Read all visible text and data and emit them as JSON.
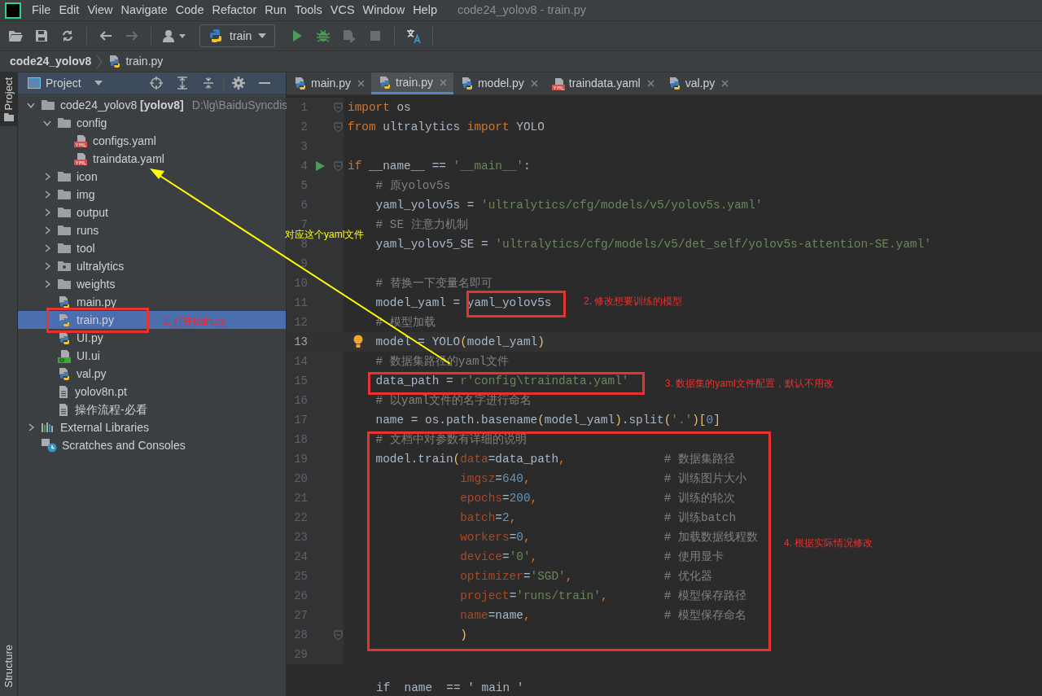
{
  "window": {
    "menu": [
      "File",
      "Edit",
      "View",
      "Navigate",
      "Code",
      "Refactor",
      "Run",
      "Tools",
      "VCS",
      "Window",
      "Help"
    ],
    "title": "code24_yolov8 - train.py"
  },
  "toolbar": [
    {
      "kind": "open",
      "disabled": false
    },
    {
      "kind": "save",
      "disabled": false
    },
    {
      "kind": "sync",
      "disabled": false
    },
    {
      "kind": "back",
      "disabled": false
    },
    {
      "kind": "forward",
      "disabled": true
    },
    {
      "kind": "user",
      "disabled": false
    },
    {
      "kind": "config",
      "label": "train",
      "disabled": false
    },
    {
      "kind": "run",
      "disabled": false
    },
    {
      "kind": "debug",
      "disabled": false
    },
    {
      "kind": "coverage",
      "disabled": true
    },
    {
      "kind": "stop",
      "disabled": true
    },
    {
      "kind": "translate",
      "disabled": false
    }
  ],
  "breadcrumb": [
    "code24_yolov8",
    "train.py"
  ],
  "side_strip": [
    "Project",
    "Structure"
  ],
  "project_panel": {
    "title": "Project",
    "tree": [
      {
        "label": "code24_yolov8 **[yolov8]**",
        "path": "D:\\lg\\BaiduSyncdis",
        "kind": "folder",
        "expanded": true,
        "selected": false,
        "children": [
          {
            "label": "config",
            "kind": "folder",
            "expanded": true,
            "selected": false,
            "children": [
              {
                "label": "configs.yaml",
                "kind": "yaml",
                "selected": false
              },
              {
                "label": "traindata.yaml",
                "kind": "yaml",
                "selected": false
              }
            ]
          },
          {
            "label": "icon",
            "kind": "folder",
            "expanded": false,
            "selected": false
          },
          {
            "label": "img",
            "kind": "folder",
            "expanded": false,
            "selected": false
          },
          {
            "label": "output",
            "kind": "folder",
            "expanded": false,
            "selected": false
          },
          {
            "label": "runs",
            "kind": "folder",
            "expanded": false,
            "selected": false
          },
          {
            "label": "tool",
            "kind": "folder",
            "expanded": false,
            "selected": false
          },
          {
            "label": "ultralytics",
            "kind": "package",
            "expanded": false,
            "selected": false
          },
          {
            "label": "weights",
            "kind": "folder",
            "expanded": false,
            "selected": false
          },
          {
            "label": "main.py",
            "kind": "python",
            "selected": false
          },
          {
            "label": "train.py",
            "kind": "python",
            "selected": true
          },
          {
            "label": "UI.py",
            "kind": "python",
            "selected": false
          },
          {
            "label": "UI.ui",
            "kind": "qt",
            "selected": false
          },
          {
            "label": "val.py",
            "kind": "python",
            "selected": false
          },
          {
            "label": "yolov8n.pt",
            "kind": "file",
            "selected": false
          },
          {
            "label": "操作流程-必看",
            "kind": "file",
            "selected": false
          }
        ]
      },
      {
        "label": "External Libraries",
        "kind": "libraries",
        "expanded": false,
        "selected": false
      },
      {
        "label": "Scratches and Consoles",
        "kind": "scratches",
        "selected": false
      }
    ]
  },
  "tabs": [
    {
      "label": "main.py",
      "kind": "python",
      "selected": false
    },
    {
      "label": "train.py",
      "kind": "python",
      "selected": true
    },
    {
      "label": "model.py",
      "kind": "python",
      "selected": false
    },
    {
      "label": "traindata.yaml",
      "kind": "yaml",
      "selected": false
    },
    {
      "label": "val.py",
      "kind": "python",
      "selected": false
    }
  ],
  "code": {
    "lines": [
      {
        "number": "1",
        "kind": "plain",
        "fold": true,
        "current": false,
        "tokens": [
          {
            "kind": "kw",
            "text": "import"
          },
          {
            "kind": "plain",
            "text": " os"
          }
        ]
      },
      {
        "number": "2",
        "kind": "plain",
        "fold": true,
        "current": false,
        "tokens": [
          {
            "kind": "kw",
            "text": "from"
          },
          {
            "kind": "plain",
            "text": " ultralytics "
          },
          {
            "kind": "kw",
            "text": "import"
          },
          {
            "kind": "plain",
            "text": " YOLO"
          }
        ]
      },
      {
        "number": "3",
        "kind": "plain",
        "fold": false,
        "current": false
      },
      {
        "number": "4",
        "kind": "run",
        "fold": true,
        "current": false,
        "tokens": [
          {
            "kind": "kw",
            "text": "if"
          },
          {
            "kind": "plain",
            "text": " __name__ == "
          },
          {
            "kind": "str",
            "text": "'__main__'"
          },
          {
            "kind": "plain",
            "text": ":"
          }
        ]
      },
      {
        "number": "5",
        "kind": "plain",
        "fold": false,
        "current": false,
        "tokens": [
          {
            "kind": "cm",
            "text": "    # 原yolov5s"
          }
        ]
      },
      {
        "number": "6",
        "kind": "plain",
        "fold": false,
        "current": false,
        "tokens": [
          {
            "kind": "plain",
            "text": "    yaml_yolov5s = "
          },
          {
            "kind": "str",
            "text": "'ultralytics/cfg/models/v5/yolov5s.yaml'"
          }
        ]
      },
      {
        "number": "7",
        "kind": "plain",
        "fold": false,
        "current": false,
        "tokens": [
          {
            "kind": "cm",
            "text": "    # SE 注意力机制"
          }
        ]
      },
      {
        "number": "8",
        "kind": "plain",
        "fold": false,
        "current": false,
        "tokens": [
          {
            "kind": "plain",
            "text": "    yaml_yolov5_SE = "
          },
          {
            "kind": "str",
            "text": "'ultralytics/cfg/models/v5/det_self/yolov5s-attention-SE.yaml'"
          }
        ]
      },
      {
        "number": "9",
        "kind": "plain",
        "fold": false,
        "current": false
      },
      {
        "number": "10",
        "kind": "plain",
        "fold": false,
        "current": false,
        "tokens": [
          {
            "kind": "cm",
            "text": "    # 替换一下变量名即可"
          }
        ]
      },
      {
        "number": "11",
        "kind": "plain",
        "fold": false,
        "current": false,
        "tokens": [
          {
            "kind": "plain",
            "text": "    model_yaml = yaml_yolov5s"
          }
        ]
      },
      {
        "number": "12",
        "kind": "plain",
        "fold": false,
        "current": false,
        "tokens": [
          {
            "kind": "cm",
            "text": "    # 模型加载"
          }
        ]
      },
      {
        "number": "13",
        "kind": "bulb",
        "fold": false,
        "current": true,
        "tokens": [
          {
            "kind": "plain",
            "text": "    model = YOLO"
          },
          {
            "kind": "br",
            "text": "("
          },
          {
            "kind": "plain",
            "text": "model_yaml"
          },
          {
            "kind": "br",
            "text": ")"
          }
        ]
      },
      {
        "number": "14",
        "kind": "plain",
        "fold": false,
        "current": false,
        "tokens": [
          {
            "kind": "cm",
            "text": "    # 数据集路径的yaml文件"
          }
        ]
      },
      {
        "number": "15",
        "kind": "plain",
        "fold": false,
        "current": false,
        "tokens": [
          {
            "kind": "plain",
            "text": "    data_path = "
          },
          {
            "kind": "str",
            "text": "r'config\\traindata.yaml'"
          }
        ]
      },
      {
        "number": "16",
        "kind": "plain",
        "fold": false,
        "current": false,
        "tokens": [
          {
            "kind": "cm",
            "text": "    # 以yaml文件的名字进行命名"
          }
        ]
      },
      {
        "number": "17",
        "kind": "plain",
        "fold": false,
        "current": false,
        "tokens": [
          {
            "kind": "plain",
            "text": "    name = os.path.basename"
          },
          {
            "kind": "br",
            "text": "("
          },
          {
            "kind": "plain",
            "text": "model_yaml"
          },
          {
            "kind": "br",
            "text": ")"
          },
          {
            "kind": "plain",
            "text": ".split"
          },
          {
            "kind": "br",
            "text": "("
          },
          {
            "kind": "str",
            "text": "'.'"
          },
          {
            "kind": "br",
            "text": ")["
          },
          {
            "kind": "num",
            "text": "0"
          },
          {
            "kind": "br",
            "text": "]"
          }
        ]
      },
      {
        "number": "18",
        "kind": "plain",
        "fold": false,
        "current": false,
        "tokens": [
          {
            "kind": "cm",
            "text": "    # 文档中对参数有详细的说明"
          }
        ]
      },
      {
        "number": "19",
        "kind": "plain",
        "fold": false,
        "current": false,
        "tokens": [
          {
            "kind": "plain",
            "text": "    model.train"
          },
          {
            "kind": "br",
            "text": "("
          },
          {
            "kind": "param",
            "text": "data"
          },
          {
            "kind": "plain",
            "text": "=data_path"
          },
          {
            "kind": "kw",
            "text": ",              "
          },
          {
            "kind": "cm",
            "text": "# 数据集路径"
          }
        ]
      },
      {
        "number": "20",
        "kind": "plain",
        "fold": false,
        "current": false,
        "tokens": [
          {
            "kind": "param",
            "text": "                imgsz"
          },
          {
            "kind": "plain",
            "text": "="
          },
          {
            "kind": "num",
            "text": "640"
          },
          {
            "kind": "kw",
            "text": ",                   "
          },
          {
            "kind": "cm",
            "text": "# 训练图片大小"
          }
        ]
      },
      {
        "number": "21",
        "kind": "plain",
        "fold": false,
        "current": false,
        "tokens": [
          {
            "kind": "param",
            "text": "                epochs"
          },
          {
            "kind": "plain",
            "text": "="
          },
          {
            "kind": "num",
            "text": "200"
          },
          {
            "kind": "kw",
            "text": ",                  "
          },
          {
            "kind": "cm",
            "text": "# 训练的轮次"
          }
        ]
      },
      {
        "number": "22",
        "kind": "plain",
        "fold": false,
        "current": false,
        "tokens": [
          {
            "kind": "param",
            "text": "                batch"
          },
          {
            "kind": "plain",
            "text": "="
          },
          {
            "kind": "num",
            "text": "2"
          },
          {
            "kind": "kw",
            "text": ",                     "
          },
          {
            "kind": "cm",
            "text": "# 训练batch"
          }
        ]
      },
      {
        "number": "23",
        "kind": "plain",
        "fold": false,
        "current": false,
        "tokens": [
          {
            "kind": "param",
            "text": "                workers"
          },
          {
            "kind": "plain",
            "text": "="
          },
          {
            "kind": "num",
            "text": "0"
          },
          {
            "kind": "kw",
            "text": ",                   "
          },
          {
            "kind": "cm",
            "text": "# 加载数据线程数"
          }
        ]
      },
      {
        "number": "24",
        "kind": "plain",
        "fold": false,
        "current": false,
        "tokens": [
          {
            "kind": "param",
            "text": "                device"
          },
          {
            "kind": "plain",
            "text": "="
          },
          {
            "kind": "str",
            "text": "'0'"
          },
          {
            "kind": "kw",
            "text": ",                  "
          },
          {
            "kind": "cm",
            "text": "# 使用显卡"
          }
        ]
      },
      {
        "number": "25",
        "kind": "plain",
        "fold": false,
        "current": false,
        "tokens": [
          {
            "kind": "param",
            "text": "                optimizer"
          },
          {
            "kind": "plain",
            "text": "="
          },
          {
            "kind": "str",
            "text": "'SGD'"
          },
          {
            "kind": "kw",
            "text": ",             "
          },
          {
            "kind": "cm",
            "text": "# 优化器"
          }
        ]
      },
      {
        "number": "26",
        "kind": "plain",
        "fold": false,
        "current": false,
        "tokens": [
          {
            "kind": "param",
            "text": "                project"
          },
          {
            "kind": "plain",
            "text": "="
          },
          {
            "kind": "str",
            "text": "'runs/train'"
          },
          {
            "kind": "kw",
            "text": ",        "
          },
          {
            "kind": "cm",
            "text": "# 模型保存路径"
          }
        ]
      },
      {
        "number": "27",
        "kind": "plain",
        "fold": false,
        "current": false,
        "tokens": [
          {
            "kind": "param",
            "text": "                name"
          },
          {
            "kind": "plain",
            "text": "=name"
          },
          {
            "kind": "kw",
            "text": ",                   "
          },
          {
            "kind": "cm",
            "text": "# 模型保存命名"
          }
        ]
      },
      {
        "number": "28",
        "kind": "plain",
        "fold": true,
        "current": false,
        "tokens": [
          {
            "kind": "br",
            "text": "                )"
          }
        ]
      },
      {
        "number": "29",
        "kind": "plain",
        "fold": false,
        "current": false
      }
    ],
    "sticky_line": "if  name  == ' main '"
  },
  "annotations": [
    {
      "kind": "box",
      "color": "#e8322f"
    },
    {
      "kind": "note",
      "text": "1. 打开train.py",
      "color": "#ff2020"
    },
    {
      "kind": "box",
      "color": "#e8322f"
    },
    {
      "kind": "note",
      "text": "2. 修改想要训练的模型",
      "color": "#e8322f"
    },
    {
      "kind": "box",
      "color": "#e8322f"
    },
    {
      "kind": "note",
      "text": "3. 数据集的yaml文件配置，默认不用改",
      "color": "#e8322f"
    },
    {
      "kind": "box",
      "color": "#e8322f"
    },
    {
      "kind": "note",
      "text": "4. 根据实际情况修改",
      "color": "#e8322f"
    },
    {
      "kind": "note",
      "text": "对应这个yaml文件",
      "color": "#ffff00"
    },
    {
      "kind": "arrow",
      "color": "#ffff00"
    }
  ]
}
